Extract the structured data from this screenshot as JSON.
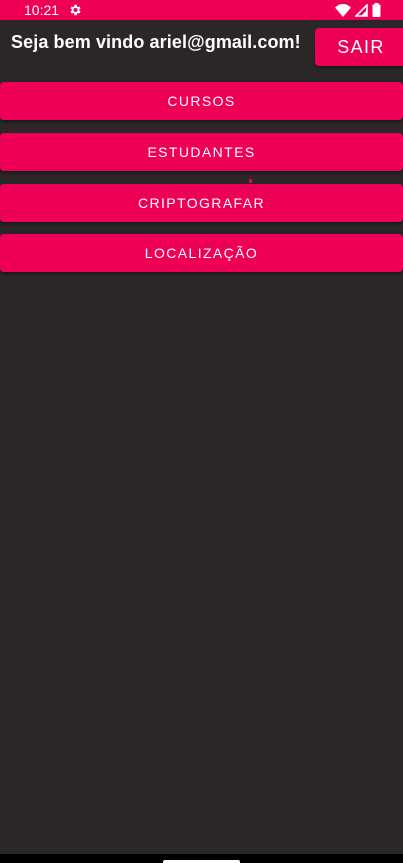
{
  "status_bar": {
    "time": "10:21",
    "icons": [
      "gear-icon",
      "wifi-icon",
      "signal-icon",
      "battery-icon"
    ]
  },
  "header": {
    "welcome_text": "Seja bem vindo ariel@gmail.com!",
    "logout_label": "SAIR"
  },
  "menu": {
    "items": [
      {
        "label": "CURSOS"
      },
      {
        "label": "ESTUDANTES"
      },
      {
        "label": "CRIPTOGRAFAR"
      },
      {
        "label": "LOCALIZAÇÃO"
      }
    ]
  },
  "colors": {
    "accent": "#ee0056",
    "background": "#2b2729",
    "text": "#ffffff"
  }
}
